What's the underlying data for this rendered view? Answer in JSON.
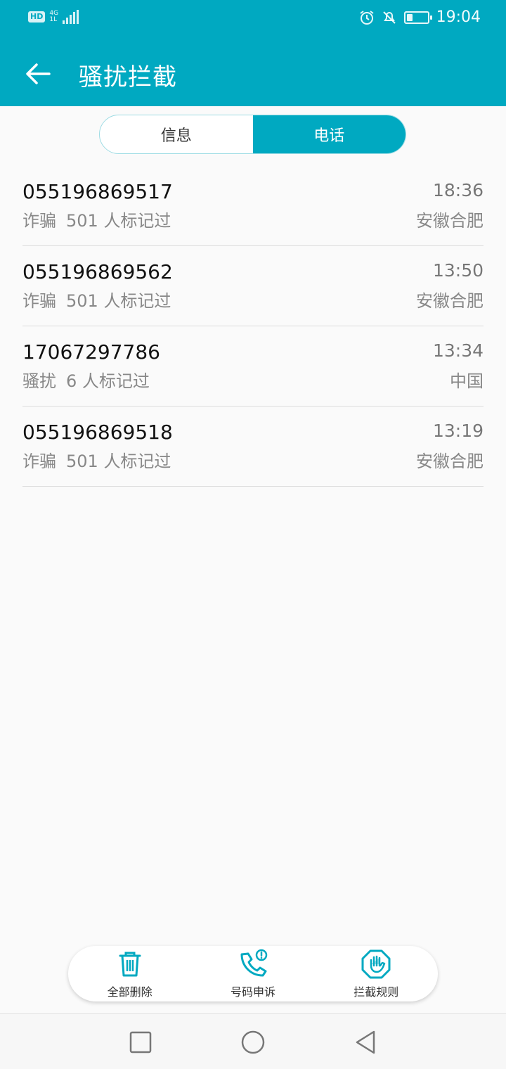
{
  "status_bar": {
    "hd": "HD",
    "network": "4G",
    "network_sub": "1L",
    "time": "19:04",
    "icons": [
      "alarm-icon",
      "mute-icon",
      "battery-icon"
    ],
    "battery_level": 0.3
  },
  "app_bar": {
    "title": "骚扰拦截",
    "back_icon": "arrow-left-icon"
  },
  "tabs": [
    {
      "label": "信息",
      "active": false
    },
    {
      "label": "电话",
      "active": true
    }
  ],
  "calls": [
    {
      "number": "055196869517",
      "time": "18:36",
      "tag": "诈骗",
      "count": "501 人标记过",
      "location": "安徽合肥"
    },
    {
      "number": "055196869562",
      "time": "13:50",
      "tag": "诈骗",
      "count": "501 人标记过",
      "location": "安徽合肥"
    },
    {
      "number": "17067297786",
      "time": "13:34",
      "tag": "骚扰",
      "count": "6 人标记过",
      "location": "中国"
    },
    {
      "number": "055196869518",
      "time": "13:19",
      "tag": "诈骗",
      "count": "501 人标记过",
      "location": "安徽合肥"
    }
  ],
  "actions": [
    {
      "label": "全部删除",
      "icon": "trash-icon"
    },
    {
      "label": "号码申诉",
      "icon": "phone-alert-icon"
    },
    {
      "label": "拦截规则",
      "icon": "hand-stop-icon"
    }
  ],
  "nav": [
    "recents-square-icon",
    "home-circle-icon",
    "back-triangle-icon"
  ],
  "colors": {
    "accent": "#00a9c1",
    "background": "#fafafa"
  }
}
